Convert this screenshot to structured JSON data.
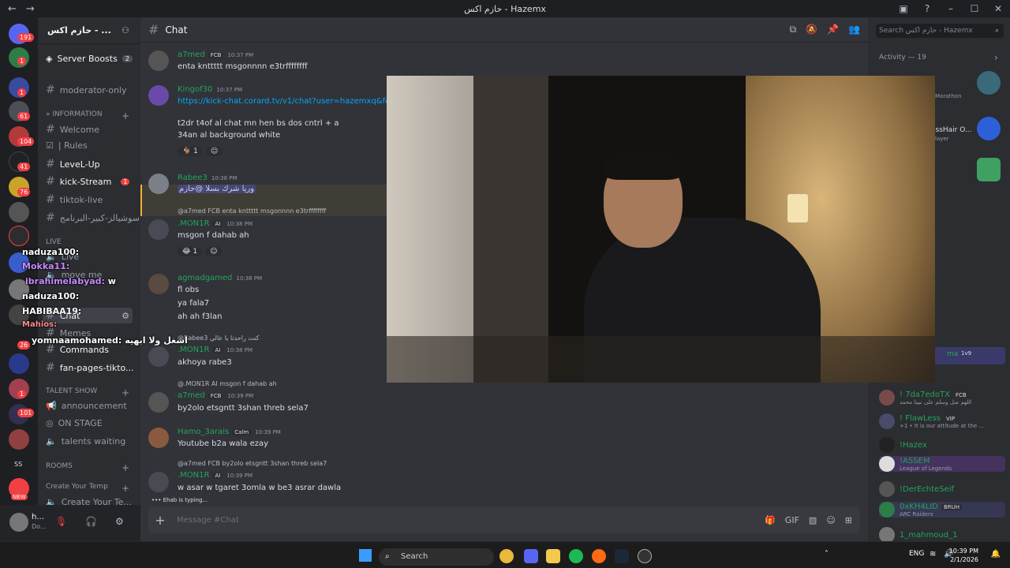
{
  "titlebar": {
    "title": "حازم اكس - Hazemx",
    "back": "←",
    "forward": "→"
  },
  "server_list": {
    "badges": [
      "191",
      "1",
      "1",
      "61",
      "104",
      "41",
      "76",
      "26",
      "1",
      "101"
    ],
    "labels": [
      "SS",
      "NEW"
    ]
  },
  "server": {
    "name": "حازم اكس - ..."
  },
  "channels": {
    "server_boosts": "Server Boosts",
    "server_boosts_count": "2",
    "moderator_only": "moderator-only",
    "cat_information": "» Information",
    "welcome": "Welcome",
    "rules": "| Rules",
    "level_up": "LeveL-Up",
    "kick_stream": "kick-Stream",
    "kick_stream_badge": "1",
    "tiktok_live": "tiktok-live",
    "social_leader": "سوشيالز-كبير-البرنامج",
    "cat_live": "LIVE",
    "live": "Live",
    "move_me": "move me",
    "chat": "Chat",
    "memes": "Memes",
    "commands": "Commands",
    "fan_pages": "fan-pages-tikto...",
    "cat_talent": "TALENT SHOW",
    "announcement": "announcement",
    "on_stage": "ON STAGE",
    "talents_waiting": "talents waiting",
    "cat_rooms": "ROOMS",
    "create_temp": "Create Your Temp",
    "create_te": "Create Your Te..."
  },
  "user": {
    "name": "h...",
    "status": "Do..."
  },
  "chat": {
    "channel": "Chat",
    "placeholder": "Message #Chat",
    "typing": "Ehab is typing...",
    "messages": [
      {
        "user": "a7med",
        "tag": "FCB",
        "time": "10:37 PM",
        "lines": [
          "enta knttttt msgonnnn e3trffffffff"
        ]
      },
      {
        "user": "Kingof30",
        "time": "10:37 PM",
        "link": "https://kick-chat.corard.tv/v1/chat?user=hazemxq&font-s",
        "lines": [
          "t2dr t4of al chat mn hen bs dos cntrl + a",
          "34an al background white"
        ],
        "reaction": "1"
      },
      {
        "user": "Rabee3",
        "time": "10:38 PM",
        "lines": [
          "وريا شرك بسلا @حازم"
        ]
      },
      {
        "reply": "@a7med FCB enta knttttt msgonnnn e3trffffffff",
        "user": ".MON1R",
        "tag": "AI",
        "time": "10:38 PM",
        "lines": [
          "msgon f dahab ah"
        ],
        "reaction": "1"
      },
      {
        "user": "agmadgamed",
        "time": "10:38 PM",
        "lines": [
          "fl obs",
          "ya fala7",
          "ah ah f3lan"
        ]
      },
      {
        "reply": "@Rabee3 كنت راحدتا يا عالي",
        "user": ".MON1R",
        "tag": "AI",
        "time": "10:38 PM",
        "lines": [
          "akhoya rabe3"
        ]
      },
      {
        "reply": "@.MON1R AI msgon f dahab ah",
        "user": "a7med",
        "tag": "FCB",
        "time": "10:39 PM",
        "lines": [
          "by2olo etsgntt 3shan threb sela7"
        ]
      },
      {
        "user": "Hamo_3arais",
        "tag": "Calm",
        "time": "10:39 PM",
        "lines": [
          "Youtube b2a wala ezay"
        ]
      },
      {
        "reply": "@a7med FCB by2olo etsgntt 3shan threb sela7",
        "user": ".MON1R",
        "tag": "AI",
        "time": "10:39 PM",
        "lines": [
          "w asar w tgaret 3omla w be3 asrar dawla"
        ]
      }
    ]
  },
  "members": {
    "search_placeholder": "Search حازم اكس - Hazemx",
    "activity": "Activity — 19",
    "partial": [
      "Marathon",
      "ossHair O...",
      "layer",
      "ma",
      "1v9"
    ],
    "list": [
      {
        "name": "! 7da7edoTX",
        "tag": "FCB",
        "sub": "اللهم صل وسلم على نبينا محمد"
      },
      {
        "name": "! FlawLess",
        "tag": "VIP",
        "sub": "+1 • It is our attitude at the ..."
      },
      {
        "name": "!Hazex",
        "sub": ""
      },
      {
        "name": "!ASSEM",
        "sub": "League of Legends"
      },
      {
        "name": "!DerEchteSeif",
        "sub": ""
      },
      {
        "name": "0xKH4LID",
        "tag": "BRUH",
        "sub": "ARC Raiders"
      },
      {
        "name": "1_mahmoud_1",
        "sub": ""
      }
    ]
  },
  "overlay_chat": [
    {
      "user": "naduza100:",
      "msg": ""
    },
    {
      "user": "Mokka11:",
      "msg": ""
    },
    {
      "user": "ibrahimelabyad:",
      "msg": "w"
    },
    {
      "user": "naduza100:",
      "msg": ""
    },
    {
      "user": "HABIBAA19:",
      "msg": ""
    },
    {
      "user": "Mahios:",
      "msg": ""
    },
    {
      "user": "yomnaamohamed:",
      "msg": "اشغل ولا ابهيه"
    }
  ],
  "taskbar": {
    "search": "Search",
    "lang": "ENG",
    "time": "10:39 PM",
    "date": "2/1/2026"
  },
  "colors": {
    "accent": "#5865f2",
    "online": "#23a55a",
    "mention": "#f0b232",
    "link": "#00a8fc"
  }
}
